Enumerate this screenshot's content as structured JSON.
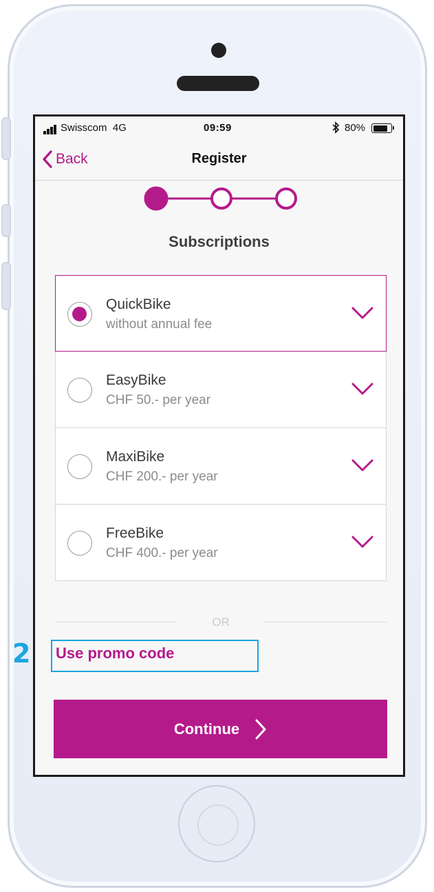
{
  "status_bar": {
    "carrier": "Swisscom",
    "network": "4G",
    "time": "09:59",
    "bluetooth_icon": "bluetooth-icon",
    "battery": "80%"
  },
  "nav": {
    "back_label": "Back",
    "title": "Register"
  },
  "stepper": {
    "total_steps": 3,
    "current_step": 1
  },
  "section_title": "Subscriptions",
  "plans": [
    {
      "name": "QuickBike",
      "price": "without annual fee",
      "selected": true
    },
    {
      "name": "EasyBike",
      "price": "CHF 50.- per year",
      "selected": false
    },
    {
      "name": "MaxiBike",
      "price": "CHF 200.- per year",
      "selected": false
    },
    {
      "name": "FreeBike",
      "price": "CHF 400.- per year",
      "selected": false
    }
  ],
  "divider_text": "OR",
  "promo_label": "Use promo code",
  "annotation_label": "2",
  "continue_label": "Continue",
  "colors": {
    "accent": "#b51a8a",
    "annotation": "#1aa6df"
  }
}
